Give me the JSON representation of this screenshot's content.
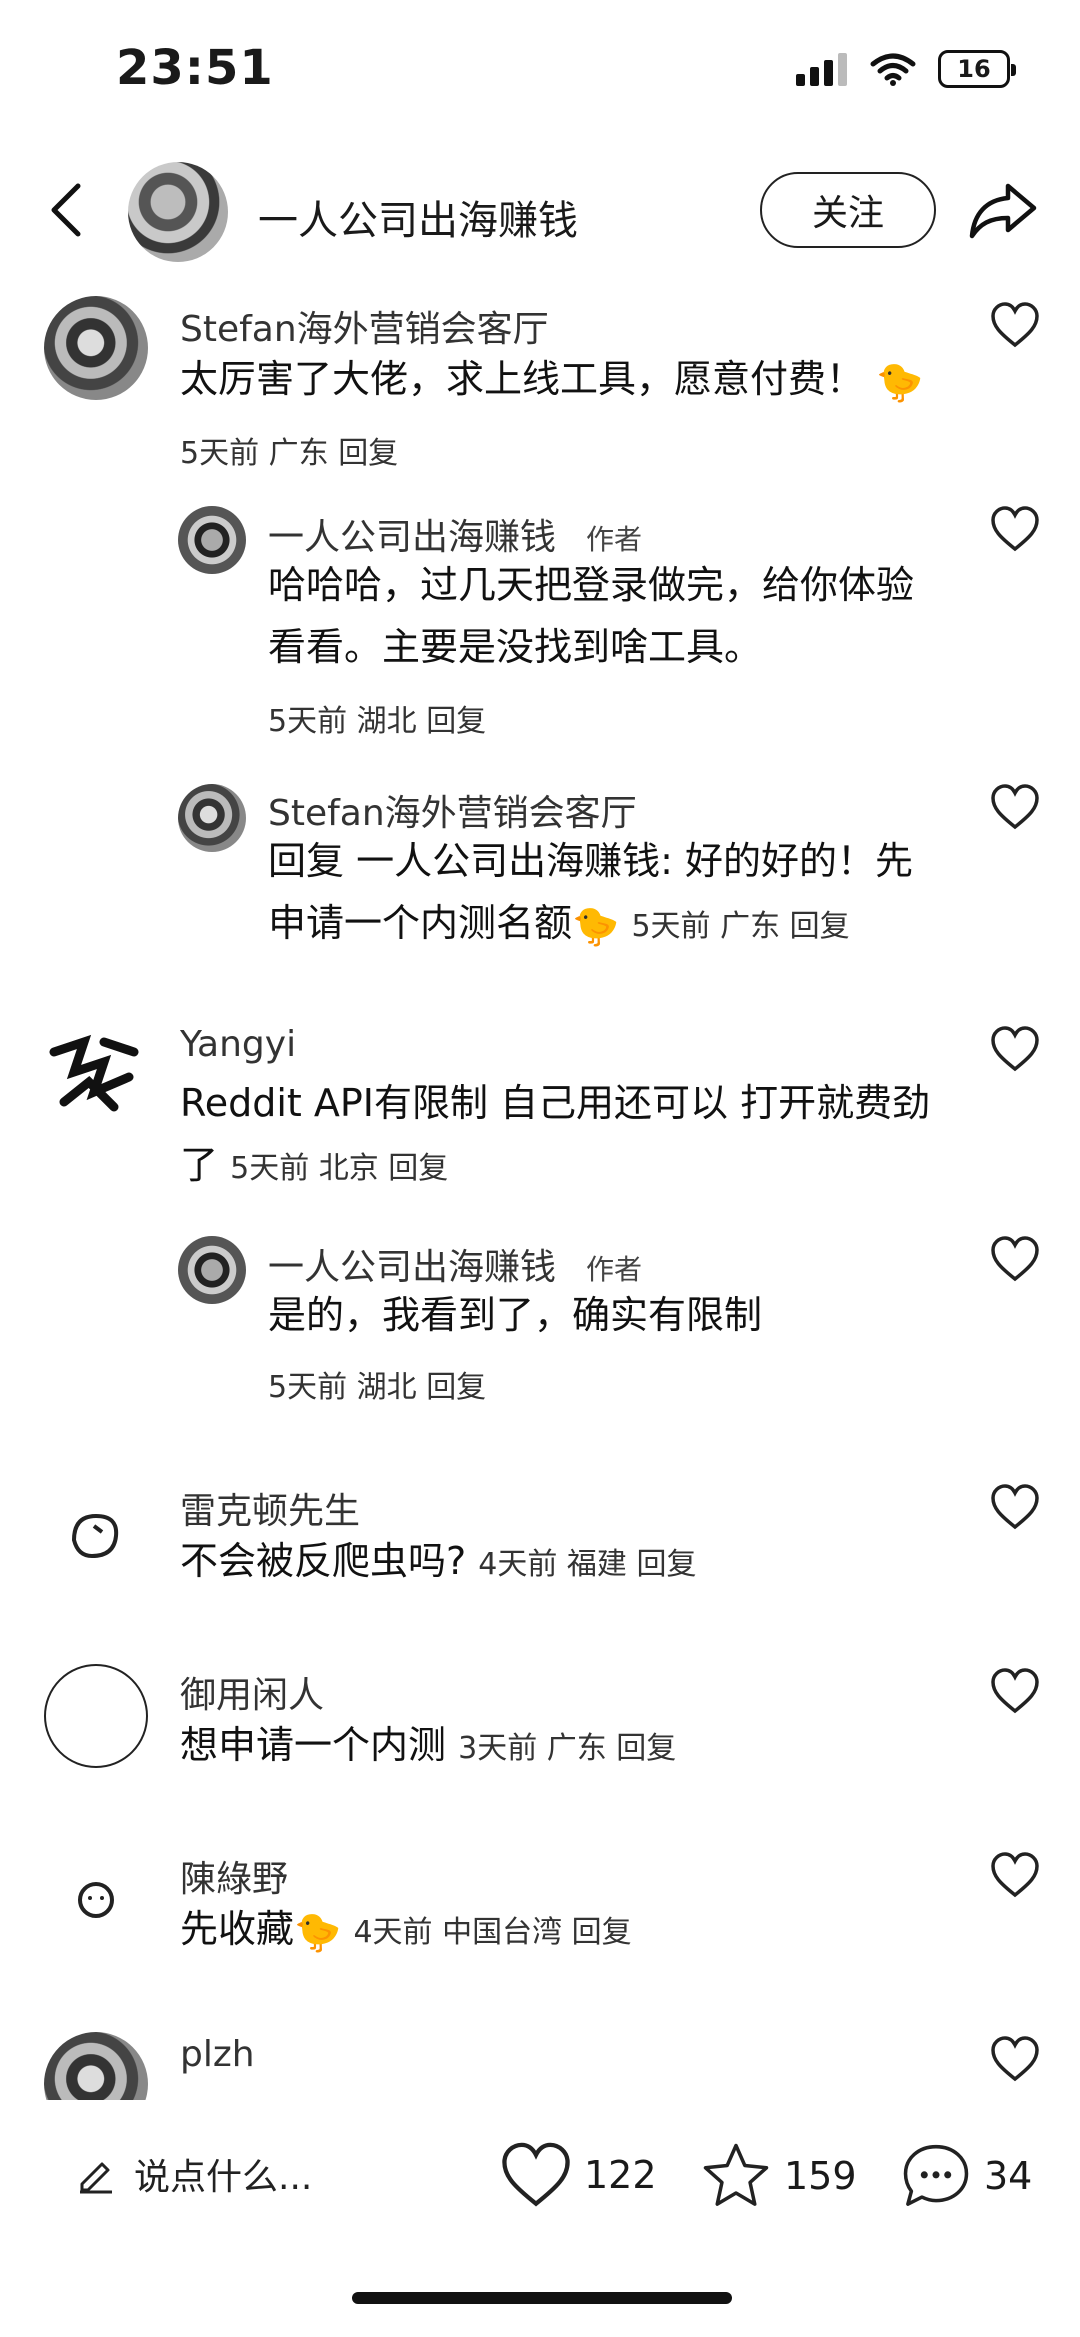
{
  "status_bar": {
    "time": "23:51",
    "battery": "16"
  },
  "header": {
    "title": "一人公司出海赚钱",
    "follow_label": "关注"
  },
  "comments": [
    {
      "author": "Stefan海外营销会客厅",
      "text": "太厉害了大佬，求上线工具，愿意付费！",
      "emoji": "🐤",
      "time": "5天前",
      "location": "广东",
      "reply": "回复"
    },
    {
      "author": "一人公司出海赚钱",
      "tag": "作者",
      "text1": "哈哈哈，过几天把登录做完，给你体验",
      "text2": "看看。主要是没找到啥工具。",
      "time": "5天前",
      "location": "湖北",
      "reply": "回复"
    },
    {
      "author": "Stefan海外营销会客厅",
      "text1": "回复 一人公司出海赚钱: 好的好的！先",
      "text2": "申请一个内测名额",
      "emoji": "🐤",
      "time": "5天前",
      "location": "广东",
      "reply": "回复"
    },
    {
      "author": "Yangyi",
      "text1": "Reddit API有限制 自己用还可以 打开就费劲",
      "text2": "了",
      "time": "5天前",
      "location": "北京",
      "reply": "回复"
    },
    {
      "author": "一人公司出海赚钱",
      "tag": "作者",
      "text": "是的，我看到了，确实有限制",
      "time": "5天前",
      "location": "湖北",
      "reply": "回复"
    },
    {
      "author": "雷克顿先生",
      "text": "不会被反爬虫吗?",
      "time": "4天前",
      "location": "福建",
      "reply": "回复"
    },
    {
      "author": "御用闲人",
      "text": "想申请一个内测",
      "time": "3天前",
      "location": "广东",
      "reply": "回复"
    },
    {
      "author": "陳綠野",
      "text": "先收藏",
      "emoji": "🐤",
      "time": "4天前",
      "location": "中国台湾",
      "reply": "回复"
    },
    {
      "author": "plzh"
    }
  ],
  "bottom_bar": {
    "input_placeholder": "说点什么...",
    "likes": "122",
    "favorites": "159",
    "comments": "34"
  }
}
